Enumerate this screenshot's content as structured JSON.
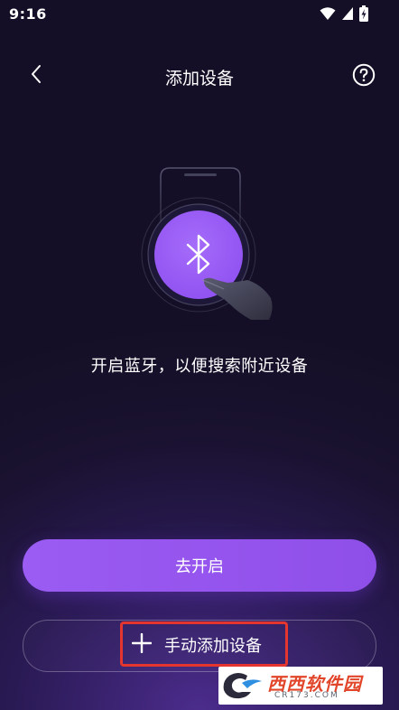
{
  "status_bar": {
    "time": "9:16",
    "icons": [
      "wifi-icon",
      "cellular-signal-icon",
      "battery-charging-icon"
    ]
  },
  "header": {
    "title": "添加设备",
    "back_icon": "chevron-left-icon",
    "help_icon": "question-circle-icon"
  },
  "illustration": {
    "icon": "bluetooth-icon",
    "accent_color": "#9b5cf6"
  },
  "hint_text": "开启蓝牙，以便搜索附近设备",
  "primary_button": {
    "label": "去开启"
  },
  "secondary_button": {
    "label": "手动添加设备",
    "icon": "plus-icon"
  },
  "watermark": {
    "text": "西西软件园",
    "url": "CR173.COM"
  },
  "colors": {
    "background": "#1a1230",
    "accent": "#9b5cf6",
    "highlight_border": "#e5352f"
  }
}
